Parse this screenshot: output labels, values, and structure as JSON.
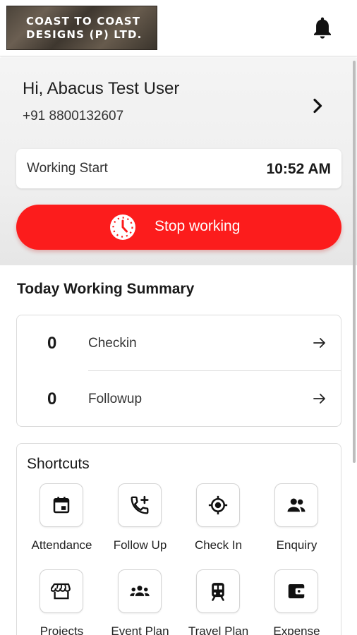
{
  "header": {
    "logo_line1": "COAST TO COAST",
    "logo_line2": "DESIGNS (P) LTD.",
    "bell_icon": "notification-bell-icon"
  },
  "profile": {
    "greeting": "Hi, Abacus Test User",
    "phone": "+91 8800132607"
  },
  "work": {
    "label": "Working Start",
    "time": "10:52 AM",
    "stop_label": "Stop working"
  },
  "summary": {
    "title": "Today Working Summary",
    "rows": [
      {
        "count": "0",
        "label": "Checkin"
      },
      {
        "count": "0",
        "label": "Followup"
      }
    ]
  },
  "shortcuts": {
    "title": "Shortcuts",
    "items": [
      {
        "label": "Attendance",
        "icon": "calendar-icon"
      },
      {
        "label": "Follow Up",
        "icon": "phone-add-icon"
      },
      {
        "label": "Check In",
        "icon": "location-target-icon"
      },
      {
        "label": "Enquiry",
        "icon": "people-icon"
      },
      {
        "label": "Projects",
        "icon": "store-icon"
      },
      {
        "label": "Event Plan",
        "icon": "group-icon"
      },
      {
        "label": "Travel Plan",
        "icon": "train-icon"
      },
      {
        "label": "Expense",
        "icon": "wallet-icon"
      }
    ]
  },
  "colors": {
    "accent": "#fc1c1c",
    "hero_bg": "#efefef"
  }
}
